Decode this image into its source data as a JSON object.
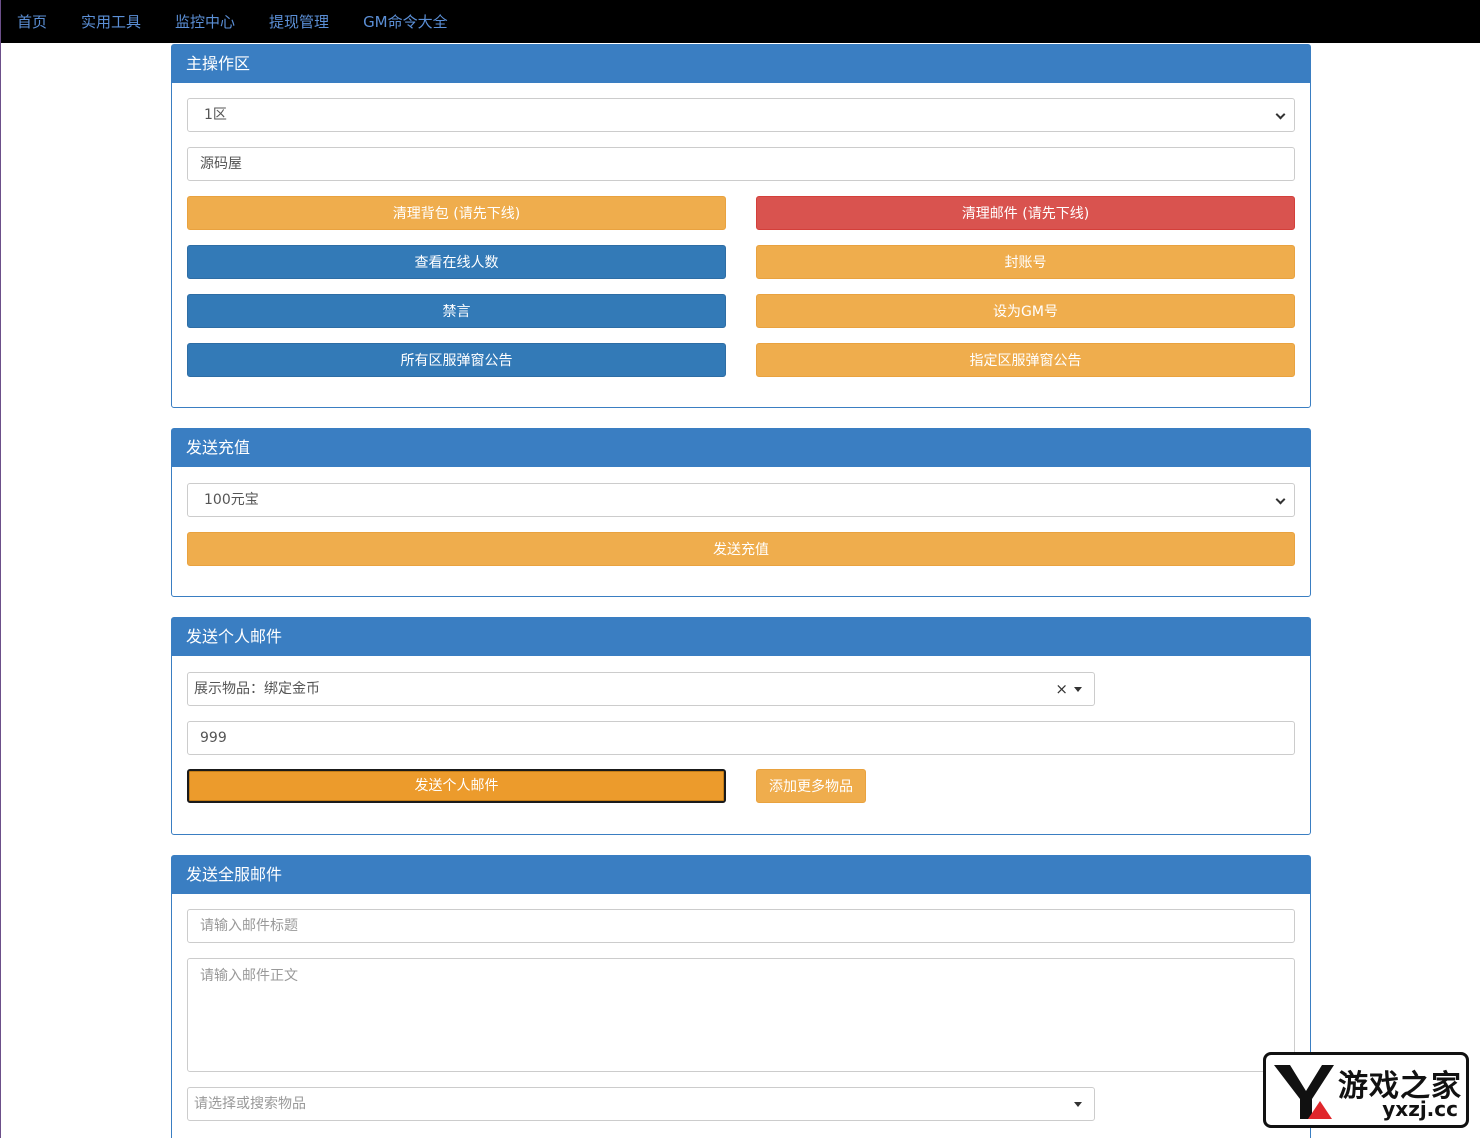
{
  "nav": {
    "items": [
      "首页",
      "实用工具",
      "监控中心",
      "提现管理",
      "GM命令大全"
    ]
  },
  "main_panel": {
    "title": "主操作区",
    "server_select": "1区",
    "account_input": "源码屋",
    "buttons": {
      "clear_bag": "清理背包 (请先下线)",
      "clear_mail": "清理邮件 (请先下线)",
      "view_online": "查看在线人数",
      "ban_account": "封账号",
      "mute": "禁言",
      "set_gm": "设为GM号",
      "all_server_notice": "所有区服弹窗公告",
      "specific_server_notice": "指定区服弹窗公告"
    }
  },
  "recharge_panel": {
    "title": "发送充值",
    "amount_select": "100元宝",
    "send_button": "发送充值"
  },
  "personal_mail_panel": {
    "title": "发送个人邮件",
    "item_select": "展示物品：绑定金币",
    "quantity_input": "999",
    "send_button": "发送个人邮件",
    "add_more_button": "添加更多物品"
  },
  "server_mail_panel": {
    "title": "发送全服邮件",
    "subject_placeholder": "请输入邮件标题",
    "body_placeholder": "请输入邮件正文",
    "item_placeholder": "请选择或搜索物品"
  },
  "watermark": {
    "cn": "游戏之家",
    "en": "yxzj.cc"
  }
}
